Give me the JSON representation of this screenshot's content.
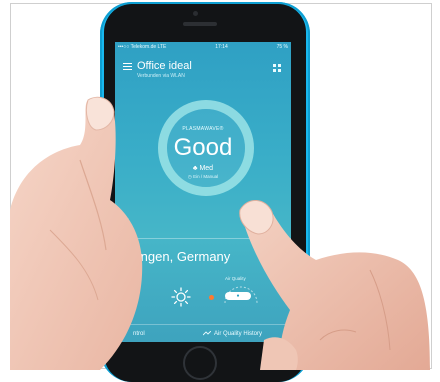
{
  "status_bar": {
    "carrier": "•••○○ Telekom.de  LTE",
    "time": "17:14",
    "battery": "75 %"
  },
  "header": {
    "title": "Office ideal",
    "subtitle": "Verbunden via WLAN"
  },
  "gauge": {
    "brand_label": "PLASMAWAVE®",
    "air_quality": "Good",
    "fan_speed": "Med",
    "mode": "Ein / Manual"
  },
  "weather": {
    "location": "Balingen, Germany",
    "temperature": "C",
    "air_quality_label": "Air Quality",
    "air_quality_pill": "●"
  },
  "bottom_bar": {
    "left_tab": "ntrol",
    "right_tab": "Air Quality History"
  },
  "colors": {
    "phone_case": "#19b8ee",
    "screen_top": "#2fa0c4",
    "screen_bottom": "#3ea3be",
    "ring": "#aaebeb",
    "accent_dot": "#ff7a2e"
  }
}
